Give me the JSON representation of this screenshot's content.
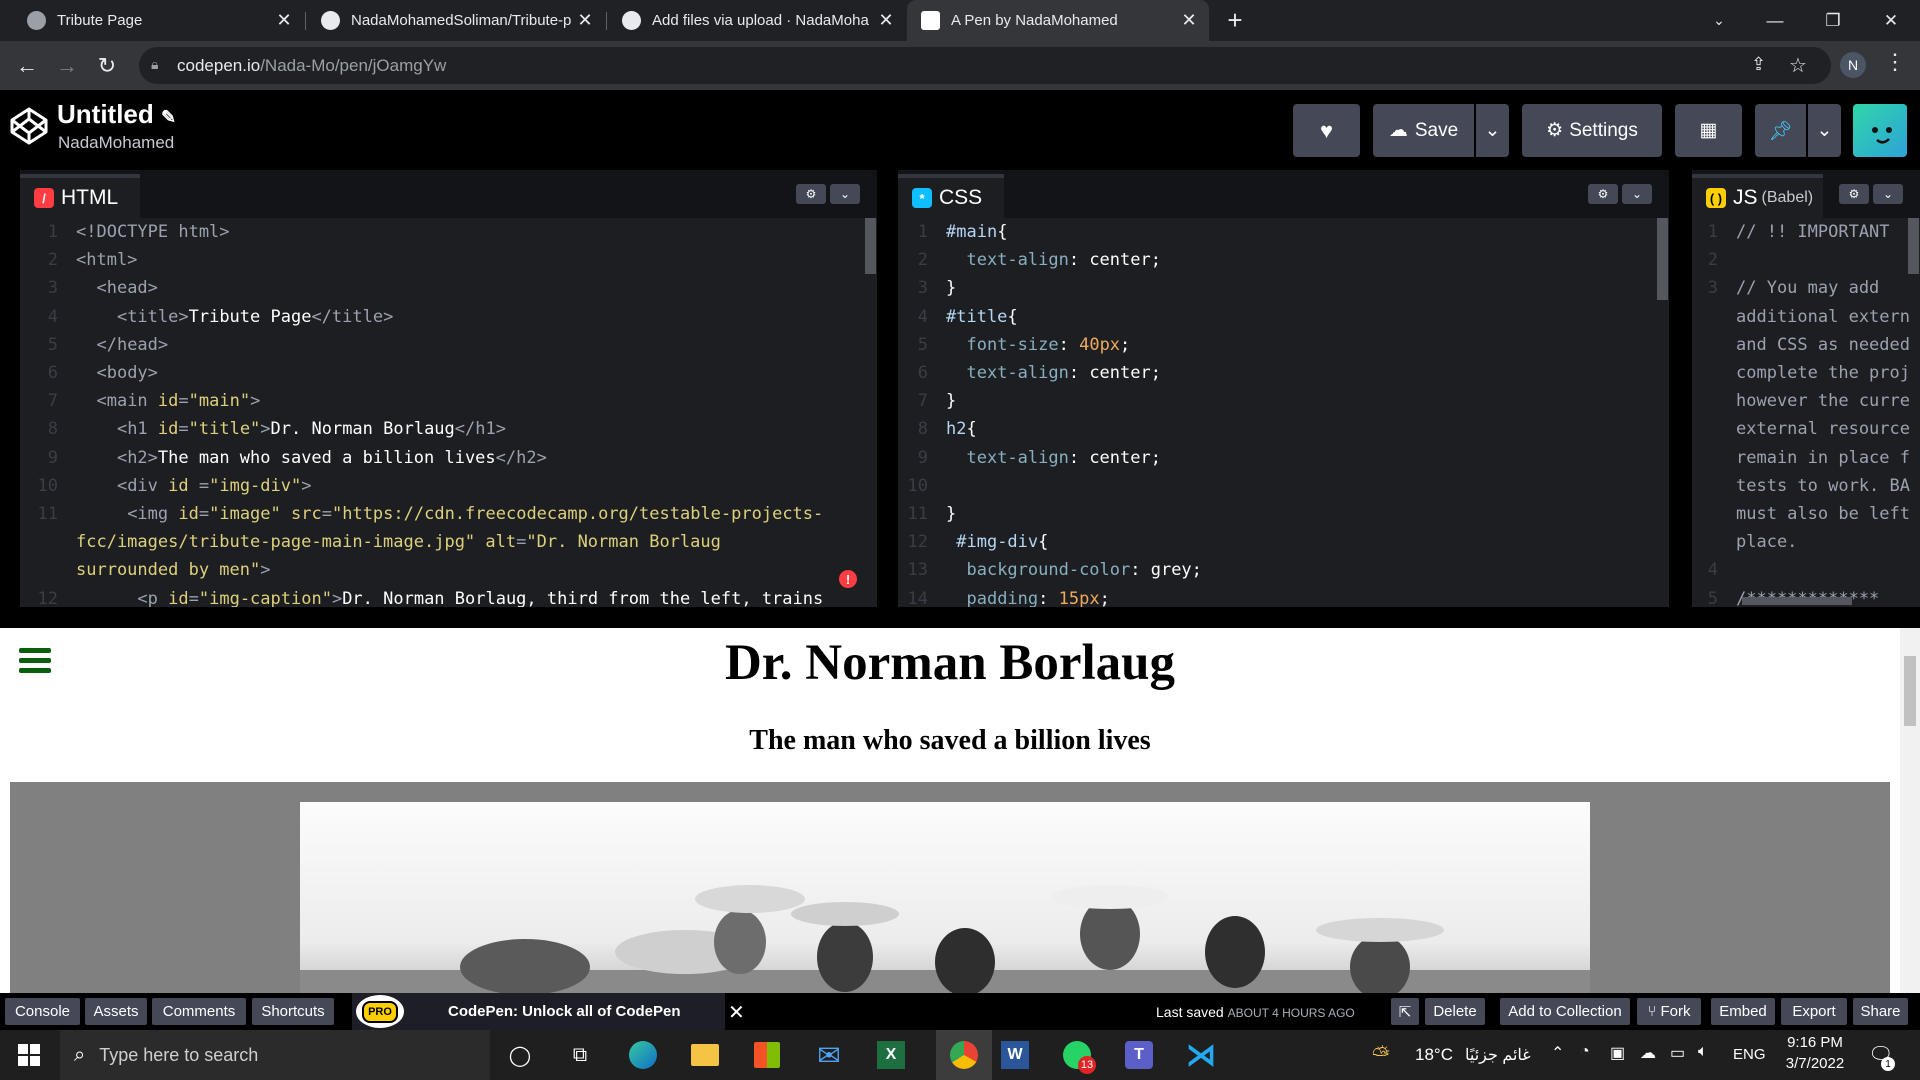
{
  "browser": {
    "tabs": [
      {
        "title": "Tribute Page",
        "favicon": "globe-icon"
      },
      {
        "title": "NadaMohamedSoliman/Tribute-p",
        "favicon": "github-icon"
      },
      {
        "title": "Add files via upload · NadaMoha",
        "favicon": "github-icon"
      },
      {
        "title": "A Pen by NadaMohamed",
        "favicon": "codepen-icon",
        "active": true
      }
    ],
    "url_host": "codepen.io",
    "url_path": "/Nada-Mo/pen/jOamgYw",
    "profile_initial": "N"
  },
  "header": {
    "title": "Untitled",
    "author": "NadaMohamed",
    "save_label": "Save",
    "settings_label": "Settings"
  },
  "editors": {
    "html": {
      "label": "HTML",
      "lines": [
        {
          "n": "1",
          "html": "<span class='t'>&lt;!DOCTYPE html&gt;</span>"
        },
        {
          "n": "2",
          "html": "<span class='t'>&lt;html&gt;</span>"
        },
        {
          "n": "3",
          "html": "  <span class='t'>&lt;head&gt;</span>"
        },
        {
          "n": "4",
          "html": "    <span class='t'>&lt;title&gt;</span>Tribute Page<span class='t'>&lt;/title&gt;</span>"
        },
        {
          "n": "5",
          "html": "  <span class='t'>&lt;/head&gt;</span>"
        },
        {
          "n": "6",
          "html": "  <span class='t'>&lt;body&gt;</span>"
        },
        {
          "n": "7",
          "html": "  <span class='t'>&lt;main </span><span class='a'>id</span><span class='t'>=</span><span class='v'>\"main\"</span><span class='t'>&gt;</span>"
        },
        {
          "n": "8",
          "html": "    <span class='t'>&lt;h1 </span><span class='a'>id</span><span class='t'>=</span><span class='v'>\"title\"</span><span class='t'>&gt;</span>Dr. Norman Borlaug<span class='t'>&lt;/h1&gt;</span>"
        },
        {
          "n": "9",
          "html": "    <span class='t'>&lt;h2&gt;</span>The man who saved a billion lives<span class='t'>&lt;/h2&gt;</span>"
        },
        {
          "n": "10",
          "html": "    <span class='t'>&lt;div </span><span class='a'>id</span><span class='t'> =</span><span class='v'>\"img-div\"</span><span class='t'>&gt;</span>"
        },
        {
          "n": "11",
          "html": "     <span class='t'>&lt;img </span><span class='a'>id</span><span class='t'>=</span><span class='v'>\"image\"</span> <span class='a'>src</span><span class='t'>=</span><span class='v'>\"https://cdn.freecodecamp.org/testable-projects-</span>"
        },
        {
          "n": "",
          "html": "<span class='v'>fcc/images/tribute-page-main-image.jpg\"</span> <span class='a'>alt</span><span class='t'>=</span><span class='v'>\"Dr. Norman Borlaug</span>"
        },
        {
          "n": "",
          "html": "<span class='v'>surrounded by men\"</span><span class='t'>&gt;</span>"
        },
        {
          "n": "12",
          "html": "      <span class='t'>&lt;p </span><span class='a'>id</span><span class='t'>=</span><span class='v'>\"img-caption\"</span><span class='t'>&gt;</span>Dr. Norman Borlaug, third from the left, trains"
        }
      ]
    },
    "css": {
      "label": "CSS",
      "lines": [
        {
          "n": "1",
          "html": "<span class='k'>#main</span>{"
        },
        {
          "n": "2",
          "html": "  <span class='c'>text-align</span>: center;"
        },
        {
          "n": "3",
          "html": "}"
        },
        {
          "n": "4",
          "html": "<span class='k'>#title</span>{"
        },
        {
          "n": "5",
          "html": "  <span class='c'>font-size</span>: <span class='n'>40px</span>;"
        },
        {
          "n": "6",
          "html": "  <span class='c'>text-align</span>: center;"
        },
        {
          "n": "7",
          "html": "}"
        },
        {
          "n": "8",
          "html": "<span class='k'>h2</span>{"
        },
        {
          "n": "9",
          "html": "  <span class='c'>text-align</span>: center;"
        },
        {
          "n": "10",
          "html": ""
        },
        {
          "n": "11",
          "html": "}"
        },
        {
          "n": "12",
          "html": " <span class='k'>#img-div</span>{"
        },
        {
          "n": "13",
          "html": "  <span class='c'>background-color</span>: grey;"
        },
        {
          "n": "14",
          "html": "  <span class='c'>padding</span>: <span class='n'>15px</span>;"
        }
      ]
    },
    "js": {
      "label": "JS",
      "sublabel": "(Babel)",
      "lines": [
        {
          "n": "1",
          "html": "<span class='t'>// !! IMPORTANT</span>"
        },
        {
          "n": "2",
          "html": ""
        },
        {
          "n": "3",
          "html": "<span class='t'>// You may add</span>"
        },
        {
          "n": "",
          "html": "<span class='t'>additional extern</span>"
        },
        {
          "n": "",
          "html": "<span class='t'>and CSS as needed</span>"
        },
        {
          "n": "",
          "html": "<span class='t'>complete the proj</span>"
        },
        {
          "n": "",
          "html": "<span class='t'>however the curre</span>"
        },
        {
          "n": "",
          "html": "<span class='t'>external resource</span>"
        },
        {
          "n": "",
          "html": "<span class='t'>remain in place f</span>"
        },
        {
          "n": "",
          "html": "<span class='t'>tests to work. BA</span>"
        },
        {
          "n": "",
          "html": "<span class='t'>must also be left</span>"
        },
        {
          "n": "",
          "html": "<span class='t'>place.</span>"
        },
        {
          "n": "4",
          "html": ""
        },
        {
          "n": "5",
          "html": "<span class='t'>/*************</span>"
        }
      ]
    }
  },
  "preview": {
    "title": "Dr. Norman Borlaug",
    "subtitle": "The man who saved a billion lives"
  },
  "bottom": {
    "console": "Console",
    "assets": "Assets",
    "comments": "Comments",
    "shortcuts": "Shortcuts",
    "pro_badge": "PRO",
    "promo": "CodePen: Unlock all of CodePen",
    "last_saved": "Last saved",
    "last_saved_when": "ABOUT 4 HOURS AGO",
    "delete": "Delete",
    "add_collection": "Add to Collection",
    "fork": "Fork",
    "embed": "Embed",
    "export": "Export",
    "share": "Share"
  },
  "taskbar": {
    "search_placeholder": "Type here to search",
    "whatsapp_badge": "13",
    "temperature": "18°C",
    "weather_text": "غائم جزئيًا",
    "lang": "ENG",
    "time": "9:16 PM",
    "date": "3/7/2022",
    "notif_count": "1"
  }
}
